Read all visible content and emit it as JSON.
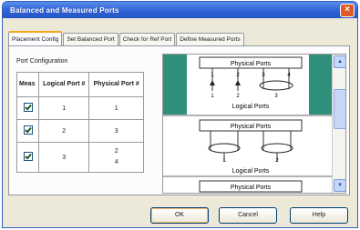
{
  "window": {
    "title": "Balanced and Measured Ports",
    "close_glyph": "×"
  },
  "tabs": [
    "Placement Config",
    "Set Balanced Port",
    "Check for Ref Port",
    "Define Measured Ports"
  ],
  "port_config": {
    "label": "Port Configuration",
    "columns": [
      "Meas",
      "Logical Port #",
      "Physical Port #"
    ],
    "rows": [
      {
        "checked": true,
        "logical": "1",
        "physical": [
          "1"
        ]
      },
      {
        "checked": true,
        "logical": "2",
        "physical": [
          "3"
        ]
      },
      {
        "checked": true,
        "logical": "3",
        "physical": [
          "2",
          "4"
        ]
      }
    ]
  },
  "diagram": {
    "physical_label": "Physical Ports",
    "logical_label": "Logical Ports",
    "block1_physical_nums": [
      "1",
      "2",
      "3",
      "4"
    ],
    "block1_logical_nums": [
      "1",
      "2",
      "3"
    ],
    "block2_logical_nums": [
      "1",
      "2"
    ],
    "scroll_up": "▲",
    "scroll_down": "▼"
  },
  "buttons": {
    "ok": "OK",
    "cancel": "Cancel",
    "help": "Help"
  },
  "colors": {
    "title_bar": "#2e62d6",
    "teal_block": "#2f8f7a",
    "tab_accent": "#f5a623"
  }
}
